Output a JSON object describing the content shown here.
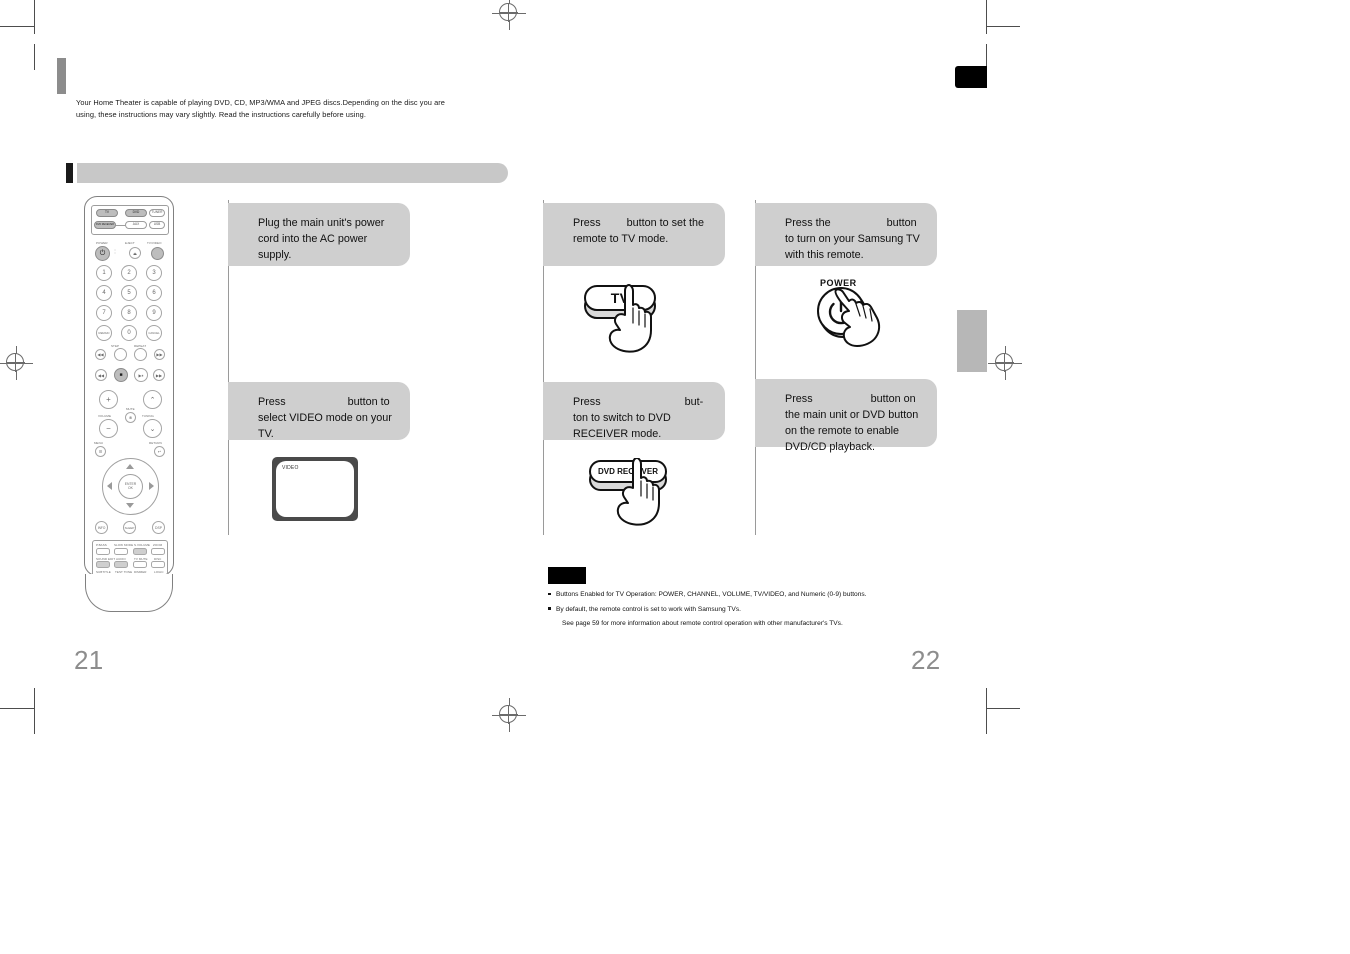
{
  "document": {
    "intro": "Your Home Theater is capable of playing DVD, CD, MP3/WMA and JPEG discs.Depending on the disc you are using, these instructions may vary slightly. Read the instructions carefully before using.",
    "section_title": "",
    "page_left": "21",
    "page_right": "22"
  },
  "steps": {
    "left_column": [
      {
        "id": "step-plug-power",
        "text": "Plug the main unit's power cord into the AC power supply."
      },
      {
        "id": "step-select-video",
        "text_before": "Press",
        "text_after": "button to select VIDEO mode on your TV."
      }
    ],
    "middle_column": [
      {
        "id": "step-tv-mode",
        "text_before": "Press",
        "text_after": "button to set the remote to TV mode."
      },
      {
        "id": "step-dvd-receiver-mode",
        "text_before": "Press",
        "text_after": "but-ton to switch to DVD RECEIVER mode."
      }
    ],
    "right_column": [
      {
        "id": "step-power-on-tv",
        "text_before": "Press the",
        "text_after": "button to turn on your Samsung TV with this remote."
      },
      {
        "id": "step-enable-playback",
        "text_before": "Press",
        "text_after": "button on the main unit or DVD button on the remote to enable DVD/CD playback."
      }
    ]
  },
  "illustrations": {
    "tv_screen_label": "VIDEO",
    "tv_button_label": "TV",
    "dvd_receiver_button_label": "DVD RECEIVER",
    "power_button_label": "POWER"
  },
  "notes": {
    "heading": "",
    "items": [
      "Buttons Enabled for TV Operation: POWER, CHANNEL, VOLUME, TV/VIDEO, and Numeric (0-9) buttons.",
      "By default, the remote control is set to work with Samsung TVs."
    ],
    "sub_item": "See page 59 for more information about remote control operation with other manufacturer's TVs."
  },
  "remote": {
    "source_pills": [
      "TV",
      "DVD",
      "TUNER",
      "DVD RECEIVER",
      "AUX",
      "USB"
    ],
    "top_labels": [
      "POWER",
      "EJECT",
      "TV/VIDEO"
    ],
    "numeric_keys": [
      "1",
      "2",
      "3",
      "4",
      "5",
      "6",
      "7",
      "8",
      "9"
    ],
    "bottom_numeric": [
      "REMAIN",
      "0",
      "CANCEL"
    ],
    "transport_labels": [
      "STEP",
      "REPEAT"
    ],
    "volume_label": "VOLUME",
    "mute_label": "MUTE",
    "tuning_label": "TUNING",
    "menu_label": "MENU",
    "return_label": "RETURN",
    "enter_label": "ENTER",
    "okay_label": "OK",
    "keypad_labels": [
      "P.BASS",
      "SLOW MODE",
      "S.VOLUME",
      "ZOOM",
      "SOUND EDIT",
      "AUDIO",
      "TV MUTE",
      "DISC",
      "SUBTITLE",
      "TEST TONE",
      "DIMMER",
      "LOGIC"
    ]
  },
  "colors": {
    "bubble_bg": "#cfcfcf",
    "title_bar": "#c8c8c8",
    "folio": "#8d8d8d",
    "rail": "#9a9a9a"
  }
}
